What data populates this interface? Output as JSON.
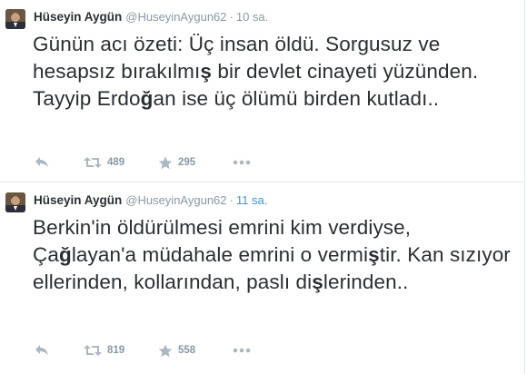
{
  "tweets": [
    {
      "fullname": "Hüseyin Aygün",
      "username": "@HuseyinAygun62",
      "separator": "·",
      "time": "10 sa.",
      "text_parts": [
        "Günün acı özeti: Üç insan öldü. Sorgusuz ve hesapsız bırakılmı",
        "ş",
        " bir devlet cinayeti yüzünden. Tayyip Erdo",
        "ğ",
        "an ise üç ölümü birden kutladı.."
      ],
      "retweets": "489",
      "favorites": "295"
    },
    {
      "fullname": "Hüseyin Aygün",
      "username": "@HuseyinAygun62",
      "separator": "·",
      "time": "11 sa.",
      "text_parts": [
        "Berkin'in öldürülmesi emrini kim verdiyse, Ça",
        "ğ",
        "layan'a müdahale emrini o vermi",
        "ş",
        "tir. Kan sızıyor ellerinden, kollarından, paslı di",
        "ş",
        "lerinden.."
      ],
      "retweets": "819",
      "favorites": "558"
    }
  ],
  "icons": {
    "reply": "reply-icon",
    "retweet": "retweet-icon",
    "favorite": "star-icon",
    "more": "more-icon"
  },
  "colors": {
    "text": "#292f33",
    "muted": "#8899a6",
    "link": "#3b94d9",
    "border": "#e1e8ed"
  }
}
